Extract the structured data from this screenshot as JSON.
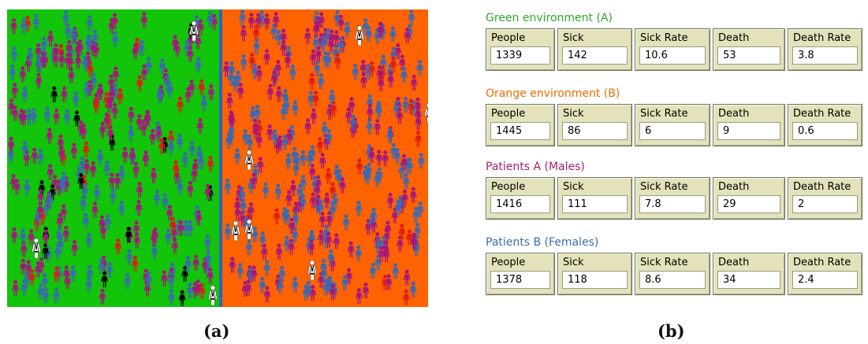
{
  "captions": {
    "a": "(a)",
    "b": "(b)"
  },
  "colors": {
    "green_env": "#12c40a",
    "orange_env": "#ff6200",
    "divider": "#2f64b8",
    "male_person": "#a6177d",
    "female_person": "#3a69b3",
    "sick_person": "#e01c14",
    "dead_person": "#000000",
    "doctor": "#ffffff",
    "title_green": "#2fa82a",
    "title_orange": "#f26a00",
    "title_males": "#a71e72",
    "title_females": "#3a6db0",
    "monitor_bg": "#e3e2ba"
  },
  "simulation": {
    "icons": [
      "person-icon",
      "doctor-icon"
    ]
  },
  "monitors": [
    {
      "title": "Green environment (A)",
      "color_key": "title_green",
      "labels": [
        "People",
        "Sick",
        "Sick Rate",
        "Death",
        "Death Rate"
      ],
      "values": [
        "1339",
        "142",
        "10.6",
        "53",
        "3.8"
      ]
    },
    {
      "title": "Orange environment (B)",
      "color_key": "title_orange",
      "labels": [
        "People",
        "Sick",
        "Sick Rate",
        "Death",
        "Death Rate"
      ],
      "values": [
        "1445",
        "86",
        "6",
        "9",
        "0.6"
      ]
    },
    {
      "title": "Patients A (Males)",
      "color_key": "title_males",
      "labels": [
        "People",
        "Sick",
        "Sick Rate",
        "Death",
        "Death Rate"
      ],
      "values": [
        "1416",
        "111",
        "7.8",
        "29",
        "2"
      ]
    },
    {
      "title": "Patients B (Females)",
      "color_key": "title_females",
      "labels": [
        "People",
        "Sick",
        "Sick Rate",
        "Death",
        "Death Rate"
      ],
      "values": [
        "1378",
        "118",
        "8.6",
        "34",
        "2.4"
      ]
    }
  ]
}
